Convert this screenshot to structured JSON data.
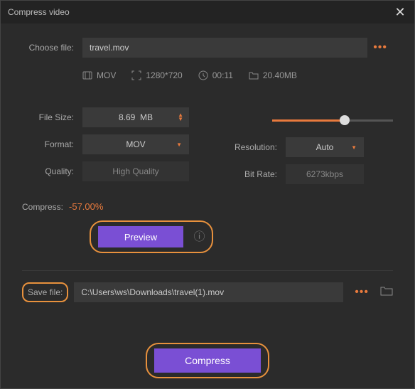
{
  "window": {
    "title": "Compress video"
  },
  "choose": {
    "label": "Choose file:",
    "value": "travel.mov"
  },
  "meta": {
    "format": "MOV",
    "resolution": "1280*720",
    "duration": "00:11",
    "size": "20.40MB"
  },
  "filesize": {
    "label": "File Size:",
    "value": "8.69",
    "unit": "MB"
  },
  "format": {
    "label": "Format:",
    "value": "MOV"
  },
  "quality": {
    "label": "Quality:",
    "value": "High Quality"
  },
  "resolution": {
    "label": "Resolution:",
    "value": "Auto"
  },
  "bitrate": {
    "label": "Bit Rate:",
    "value": "6273kbps"
  },
  "compress": {
    "label": "Compress:",
    "value": "-57.00%"
  },
  "preview": {
    "label": "Preview"
  },
  "save": {
    "label": "Save file:",
    "value": "C:\\Users\\ws\\Downloads\\travel(1).mov"
  },
  "action": {
    "label": "Compress"
  }
}
